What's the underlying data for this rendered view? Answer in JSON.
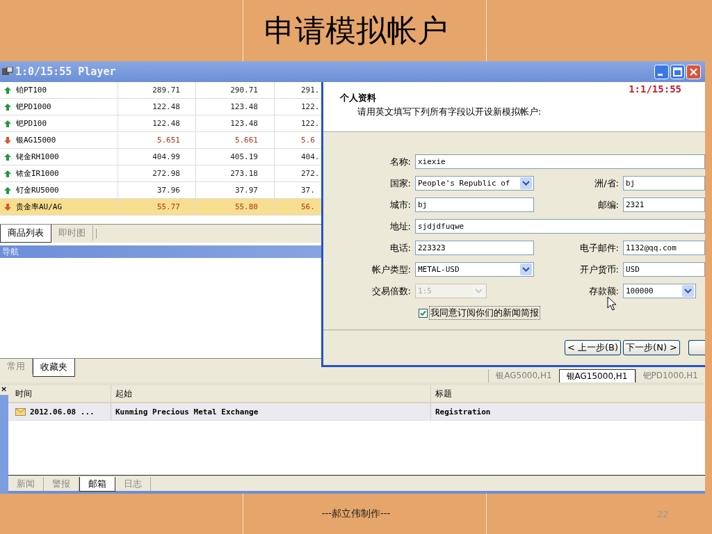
{
  "slide": {
    "title": "申请模拟帐户",
    "footer": "---郝立伟制作---",
    "page_number": "22"
  },
  "window": {
    "title": "1:0/15:55 Player"
  },
  "quotes": [
    {
      "name": "铂PT100",
      "kind": "up",
      "selected": false,
      "values": [
        "289.71",
        "290.71",
        "291."
      ]
    },
    {
      "name": "钯PD1000",
      "kind": "up",
      "selected": false,
      "values": [
        "122.48",
        "123.48",
        "122."
      ]
    },
    {
      "name": "钯PD100",
      "kind": "up",
      "selected": false,
      "values": [
        "122.48",
        "123.48",
        "122."
      ]
    },
    {
      "name": "银AG15000",
      "kind": "down",
      "selected": false,
      "values": [
        "5.651",
        "5.661",
        "5.6"
      ]
    },
    {
      "name": "铑金RH1000",
      "kind": "up",
      "selected": false,
      "values": [
        "404.99",
        "405.19",
        "404."
      ]
    },
    {
      "name": "铱金IR1000",
      "kind": "up",
      "selected": false,
      "values": [
        "272.98",
        "273.18",
        "272."
      ]
    },
    {
      "name": "钌金RU5000",
      "kind": "up",
      "selected": false,
      "values": [
        "37.96",
        "37.97",
        "37."
      ]
    },
    {
      "name": "贵金率AU/AG",
      "kind": "down",
      "selected": true,
      "values": [
        "55.77",
        "55.80",
        "56."
      ]
    }
  ],
  "quote_tabs": [
    {
      "label": "商品列表",
      "selected": true
    },
    {
      "label": "即时图",
      "selected": false
    }
  ],
  "nav_panel": {
    "title": "导航"
  },
  "nav_tabs": [
    {
      "label": "常用",
      "selected": false
    },
    {
      "label": "收藏夹",
      "selected": true
    }
  ],
  "chart_tabs": [
    {
      "label": "银AG5000,H1",
      "selected": false
    },
    {
      "label": "银AG15000,H1",
      "selected": true
    },
    {
      "label": "钯PD1000,H1",
      "selected": false
    }
  ],
  "mail": {
    "close_glyph": "×",
    "columns": [
      "时间",
      "起始",
      "标题"
    ],
    "rows": [
      {
        "time": "2012.06.08 ...",
        "from": "Kunming Precious Metal Exchange",
        "subject": "Registration"
      }
    ]
  },
  "bottom_tabs": [
    {
      "label": "新闻",
      "selected": false
    },
    {
      "label": "警报",
      "selected": false
    },
    {
      "label": "邮箱",
      "selected": true
    },
    {
      "label": "日志",
      "selected": false
    }
  ],
  "dialog": {
    "timer": "1:1/15:55",
    "heading": "个人资料",
    "subtitle": "请用英文填写下列所有字段以开设新模拟帐户:",
    "rows": [
      [
        {
          "label": "名称:",
          "value": "xiexie",
          "kind": "text",
          "disabled": false
        }
      ],
      [
        {
          "label": "国家:",
          "value": "People's Republic of",
          "kind": "select",
          "disabled": false
        },
        {
          "label": "洲/省:",
          "value": "bj",
          "kind": "text",
          "disabled": false
        }
      ],
      [
        {
          "label": "城市:",
          "value": "bj",
          "kind": "text",
          "disabled": false
        },
        {
          "label": "邮编:",
          "value": "2321",
          "kind": "text",
          "disabled": false
        }
      ],
      [
        {
          "label": "地址:",
          "value": "sjdjdfuqwe",
          "kind": "text",
          "disabled": false
        }
      ],
      [
        {
          "label": "电话:",
          "value": "223323",
          "kind": "text",
          "disabled": false
        },
        {
          "label": "电子邮件:",
          "value": "1132@qq.com",
          "kind": "text",
          "disabled": false
        }
      ],
      [
        {
          "label": "帐户类型:",
          "value": "METAL-USD",
          "kind": "select",
          "disabled": false
        },
        {
          "label": "开户货币:",
          "value": "USD",
          "kind": "text",
          "disabled": false
        }
      ],
      [
        {
          "label": "交易倍数:",
          "value": "1:5",
          "kind": "select",
          "disabled": true
        },
        {
          "label": "存款额:",
          "value": "100000",
          "kind": "select",
          "disabled": false
        }
      ]
    ],
    "checkbox": {
      "label": "我同意订阅你们的新闻简报",
      "checked": true
    },
    "buttons": [
      "< 上一步(B)",
      "下一步(N) >"
    ]
  }
}
